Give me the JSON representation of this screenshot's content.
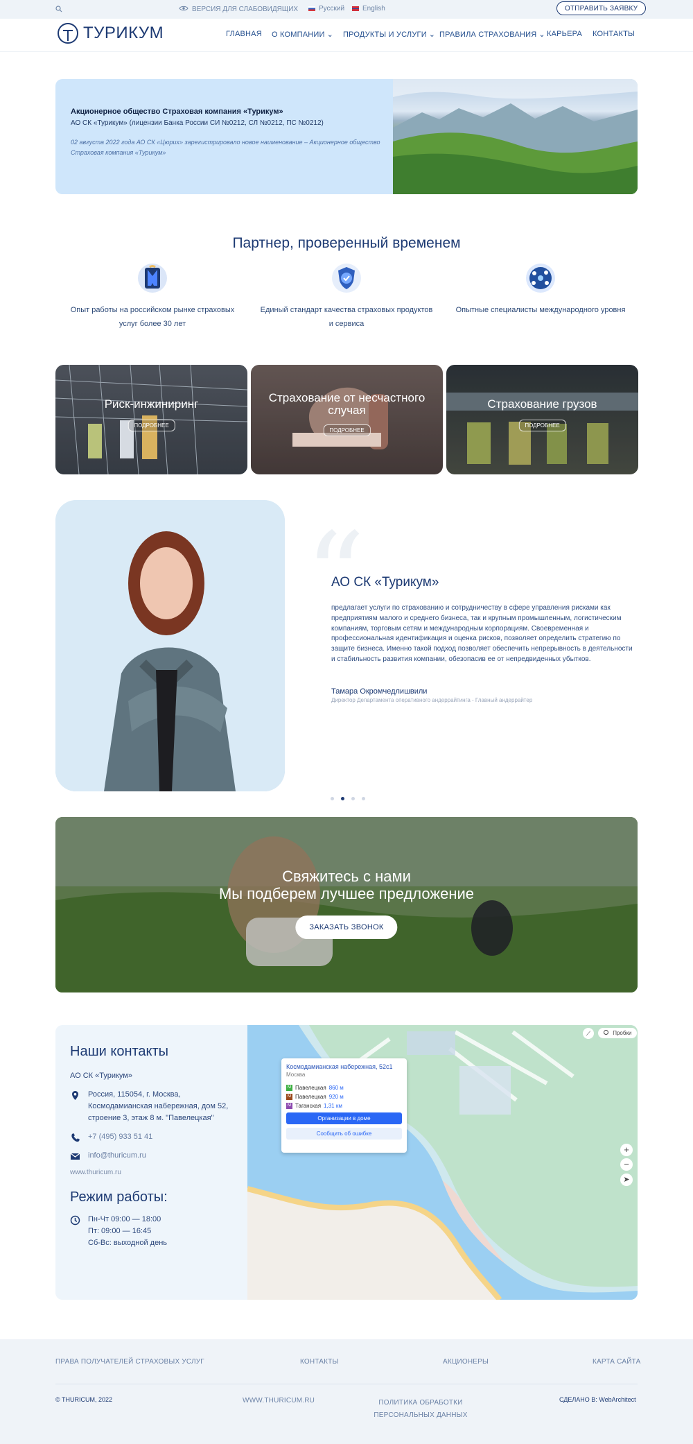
{
  "topbar": {
    "search_icon": "search-icon",
    "accessibility": "ВЕРСИЯ ДЛЯ СЛАБОВИДЯЩИХ",
    "lang_ru": "Русский",
    "lang_en": "English",
    "submit_label": "ОТПРАВИТЬ ЗАЯВКУ"
  },
  "nav": {
    "logo_text": "ТУРИКУМ",
    "items": [
      {
        "label": "ГЛАВНАЯ"
      },
      {
        "label": "О КОМПАНИИ"
      },
      {
        "label": "ПРОДУКТЫ И УСЛУГИ"
      },
      {
        "label": "ПРАВИЛА СТРАХОВАНИЯ"
      },
      {
        "label": "КАРЬЕРА"
      },
      {
        "label": "КОНТАКТЫ"
      }
    ]
  },
  "hero": {
    "title": "Акционерное общество Страховая компания «Турикум»",
    "subtitle": "АО СК «Турикум» (лицензии Банка России СИ №0212, СЛ №0212, ПС №0212)",
    "note": "02 августа 2022 года АО СК «Цюрих» зарегистрировало новое наименование – Акционерное общество Страховая компания «Турикум»"
  },
  "partner": {
    "title": "Партнер, проверенный временем",
    "features": [
      {
        "text": "Опыт работы на российском рынке страховых услуг более 30 лет"
      },
      {
        "text": "Единый стандарт качества страховых продуктов и сервиса"
      },
      {
        "text": "Опытные специалисты международного уровня"
      }
    ]
  },
  "cards": [
    {
      "title": "Риск-инжиниринг",
      "button": "ПОДРОБНЕЕ"
    },
    {
      "title": "Страхование от несчастного случая",
      "button": "ПОДРОБНЕЕ"
    },
    {
      "title": "Страхование грузов",
      "button": "ПОДРОБНЕЕ"
    }
  ],
  "quote": {
    "title": "АО СК «Турикум»",
    "body": "предлагает услуги по страхованию и сотрудничеству в сфере управления рисками как предприятиям малого и среднего бизнеса, так и крупным промышленным, логистическим компаниям, торговым сетям и международным корпорациям. Своевременная и профессиональная идентификация и оценка рисков, позволяет определить стратегию по защите бизнеса. Именно такой подход позволяет обеспечить непрерывность в деятельности и стабильность развития компании, обезопасив ее от непредвиденных убытков.",
    "author": "Тамара Окромчедлишвили",
    "role": "Директор Департамента оперативного андеррайтинга - Главный андеррайтер"
  },
  "cta": {
    "line1": "Свяжитесь с нами",
    "line2": "Мы подберем лучшее предложение",
    "button": "ЗАКАЗАТЬ ЗВОНОК"
  },
  "contacts": {
    "title": "Наши контакты",
    "company": "АО СК «Турикум»",
    "address": "Россия, 115054, г. Москва, Космодамианская набережная, дом 52, строение 3, этаж 8 м. \"Павелецкая\"",
    "phone": "+7 (495) 933 51 41",
    "email": "info@thuricum.ru",
    "website": "www.thuricum.ru",
    "hours_title": "Режим работы:",
    "hours": [
      "Пн-Чт 09:00 — 18:00",
      "Пт: 09:00 — 16:45",
      "Сб-Вс: выходной день"
    ],
    "map_popup": {
      "title": "Космодамианская набережная, 52с1",
      "city": "Москва",
      "rows": [
        {
          "station": "Павелецкая",
          "distance": "860 м"
        },
        {
          "station": "Павелецкая",
          "distance": "920 м"
        },
        {
          "station": "Таганская",
          "distance": "1,31 км"
        }
      ],
      "button1": "Организации в доме",
      "button2": "Сообщить об ошибке",
      "traffic": "Пробки"
    }
  },
  "footer": {
    "links": [
      "ПРАВА ПОЛУЧАТЕЛЕЙ СТРАХОВЫХ УСЛУГ",
      "КОНТАКТЫ",
      "АКЦИОНЕРЫ",
      "КАРТА САЙТА"
    ],
    "copyright": "© THURICUM, 2022",
    "site": "WWW.THURICUM.RU",
    "policy": "ПОЛИТИКА ОБРАБОТКИ ПЕРСОНАЛЬНЫХ ДАННЫХ",
    "made_by": "СДЕЛАНО В: WebArchitect"
  },
  "colors": {
    "brand": "#1d3a73",
    "hero_bg": "#cfe6fb",
    "footer_bg": "#eff3f8"
  }
}
